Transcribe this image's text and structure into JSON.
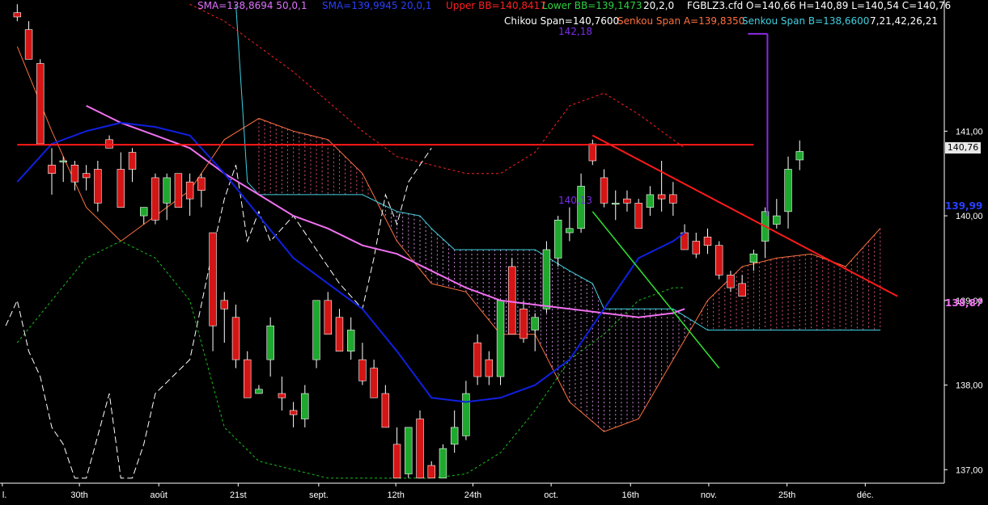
{
  "header": {
    "sma1": "SMA=138,8694  50,0,1",
    "sma2": "SMA=139,9945  20,0,1",
    "upper_bb": "Upper BB=140,8417",
    "lower_bb": "Lower BB=139,1473",
    "bb_params": "20,2,0",
    "ohlc": "FGBLZ3.cfd O=140,66 H=140,89 L=140,54 C=140,76",
    "chikou": "Chikou Span=140,7600",
    "senkou_a": "Senkou Span A=139,8350",
    "senkou_b": "Senkou Span B=138,6600",
    "ichimoku_params": "7,21,42,26,21"
  },
  "annotations": {
    "high_marker": "142,18",
    "low_marker": "140,13"
  },
  "price_axis": {
    "current_price": "140,76",
    "right_marker_1": "139,99",
    "right_marker_2": "138,87"
  },
  "colors": {
    "background": "#000000",
    "bull": "#1fa82e",
    "bear": "#d41515",
    "sma20": "#1020e0",
    "sma50": "#f070f0",
    "upper_bb": "#ff2020",
    "lower_bb": "#18c018",
    "senkou_a": "#ff7040",
    "senkou_b": "#40d0e0",
    "chikou": "#ffffff",
    "purple": "#8a2be2"
  },
  "chart_data": {
    "type": "candlestick",
    "instrument": "FGBLZ3.cfd",
    "ylim": [
      136.85,
      142.55
    ],
    "xlim": [
      -1.5,
      80.5
    ],
    "yticks": [
      {
        "value": 137,
        "label": "137,00"
      },
      {
        "value": 138,
        "label": "138,00"
      },
      {
        "value": 139,
        "label": "139,00"
      },
      {
        "value": 140,
        "label": "140,00"
      },
      {
        "value": 141,
        "label": "141,00"
      }
    ],
    "xticks": [
      {
        "x": -1.3,
        "label": "l."
      },
      {
        "x": 5.4,
        "label": "30th"
      },
      {
        "x": 12.3,
        "label": "août"
      },
      {
        "x": 19.2,
        "label": "21st"
      },
      {
        "x": 26.2,
        "label": "sept."
      },
      {
        "x": 32.9,
        "label": "12th"
      },
      {
        "x": 39.6,
        "label": "24th"
      },
      {
        "x": 46.4,
        "label": "oct."
      },
      {
        "x": 53.3,
        "label": "16th"
      },
      {
        "x": 60.1,
        "label": "nov."
      },
      {
        "x": 66.9,
        "label": "25th"
      },
      {
        "x": 73.7,
        "label": "déc."
      }
    ],
    "candles": [
      {
        "o": 142.4,
        "h": 142.5,
        "l": 142.3,
        "c": 142.35
      },
      {
        "o": 142.2,
        "h": 142.3,
        "l": 141.85,
        "c": 141.85
      },
      {
        "o": 141.8,
        "h": 141.85,
        "l": 140.85,
        "c": 140.85
      },
      {
        "o": 140.6,
        "h": 140.8,
        "l": 140.25,
        "c": 140.5
      },
      {
        "o": 140.65,
        "h": 140.7,
        "l": 140.4,
        "c": 140.65
      },
      {
        "o": 140.6,
        "h": 140.65,
        "l": 140.3,
        "c": 140.4
      },
      {
        "o": 140.5,
        "h": 140.6,
        "l": 140.3,
        "c": 140.45
      },
      {
        "o": 140.55,
        "h": 140.65,
        "l": 140.05,
        "c": 140.15
      },
      {
        "o": 140.9,
        "h": 140.95,
        "l": 140.85,
        "c": 140.8
      },
      {
        "o": 140.55,
        "h": 140.75,
        "l": 140.1,
        "c": 140.1
      },
      {
        "o": 140.75,
        "h": 140.8,
        "l": 140.4,
        "c": 140.55
      },
      {
        "o": 140.0,
        "h": 140.1,
        "l": 139.9,
        "c": 140.1
      },
      {
        "o": 140.45,
        "h": 140.5,
        "l": 139.9,
        "c": 139.95
      },
      {
        "o": 140.15,
        "h": 140.5,
        "l": 139.95,
        "c": 140.45
      },
      {
        "o": 140.5,
        "h": 140.5,
        "l": 140.1,
        "c": 140.1
      },
      {
        "o": 140.4,
        "h": 140.5,
        "l": 140.0,
        "c": 140.2
      },
      {
        "o": 140.45,
        "h": 140.5,
        "l": 140.1,
        "c": 140.3
      },
      {
        "o": 139.8,
        "h": 139.8,
        "l": 138.4,
        "c": 138.7
      },
      {
        "o": 139.0,
        "h": 139.1,
        "l": 138.5,
        "c": 138.9
      },
      {
        "o": 138.8,
        "h": 138.95,
        "l": 138.2,
        "c": 138.3
      },
      {
        "o": 138.3,
        "h": 138.4,
        "l": 137.85,
        "c": 137.85
      },
      {
        "o": 137.9,
        "h": 138.0,
        "l": 137.9,
        "c": 137.95
      },
      {
        "o": 138.3,
        "h": 138.8,
        "l": 138.1,
        "c": 138.7
      },
      {
        "o": 137.9,
        "h": 138.1,
        "l": 137.7,
        "c": 137.85
      },
      {
        "o": 137.7,
        "h": 137.8,
        "l": 137.5,
        "c": 137.65
      },
      {
        "o": 137.6,
        "h": 138.0,
        "l": 137.5,
        "c": 137.9
      },
      {
        "o": 138.3,
        "h": 139.0,
        "l": 138.2,
        "c": 139.0
      },
      {
        "o": 139.0,
        "h": 139.1,
        "l": 138.6,
        "c": 138.6
      },
      {
        "o": 138.8,
        "h": 138.9,
        "l": 138.4,
        "c": 138.4
      },
      {
        "o": 138.4,
        "h": 138.8,
        "l": 138.3,
        "c": 138.65
      },
      {
        "o": 138.3,
        "h": 138.5,
        "l": 138.0,
        "c": 138.05
      },
      {
        "o": 138.2,
        "h": 138.3,
        "l": 137.85,
        "c": 137.85
      },
      {
        "o": 137.9,
        "h": 138.0,
        "l": 137.5,
        "c": 137.5
      },
      {
        "o": 137.3,
        "h": 137.5,
        "l": 136.9,
        "c": 136.9
      },
      {
        "o": 136.95,
        "h": 137.5,
        "l": 136.9,
        "c": 137.5
      },
      {
        "o": 137.6,
        "h": 137.7,
        "l": 136.9,
        "c": 136.9
      },
      {
        "o": 137.05,
        "h": 137.1,
        "l": 136.9,
        "c": 136.9
      },
      {
        "o": 136.9,
        "h": 137.3,
        "l": 136.9,
        "c": 137.25
      },
      {
        "o": 137.3,
        "h": 137.7,
        "l": 137.2,
        "c": 137.5
      },
      {
        "o": 137.4,
        "h": 138.05,
        "l": 137.35,
        "c": 137.9
      },
      {
        "o": 138.5,
        "h": 138.6,
        "l": 138.0,
        "c": 138.1
      },
      {
        "o": 138.3,
        "h": 138.4,
        "l": 138.0,
        "c": 138.1
      },
      {
        "o": 138.1,
        "h": 139.0,
        "l": 138.0,
        "c": 139.0
      },
      {
        "o": 139.4,
        "h": 139.5,
        "l": 138.6,
        "c": 138.6
      },
      {
        "o": 138.9,
        "h": 139.0,
        "l": 138.5,
        "c": 138.55
      },
      {
        "o": 138.65,
        "h": 138.85,
        "l": 138.4,
        "c": 138.8
      },
      {
        "o": 138.9,
        "h": 139.7,
        "l": 138.85,
        "c": 139.6
      },
      {
        "o": 139.5,
        "h": 140.0,
        "l": 139.4,
        "c": 139.95
      },
      {
        "o": 139.8,
        "h": 140.1,
        "l": 139.7,
        "c": 139.85
      },
      {
        "o": 139.85,
        "h": 140.5,
        "l": 139.8,
        "c": 140.35
      },
      {
        "o": 140.85,
        "h": 140.9,
        "l": 140.6,
        "c": 140.65
      },
      {
        "o": 140.45,
        "h": 140.55,
        "l": 140.1,
        "c": 140.15
      },
      {
        "o": 140.15,
        "h": 140.3,
        "l": 139.95,
        "c": 140.15
      },
      {
        "o": 140.2,
        "h": 140.3,
        "l": 140.05,
        "c": 140.15
      },
      {
        "o": 140.15,
        "h": 140.2,
        "l": 139.85,
        "c": 139.85
      },
      {
        "o": 140.1,
        "h": 140.35,
        "l": 140.0,
        "c": 140.25
      },
      {
        "o": 140.25,
        "h": 140.65,
        "l": 140.05,
        "c": 140.2
      },
      {
        "o": 140.25,
        "h": 140.4,
        "l": 140.0,
        "c": 140.15
      },
      {
        "o": 139.8,
        "h": 139.9,
        "l": 139.6,
        "c": 139.6
      },
      {
        "o": 139.7,
        "h": 139.8,
        "l": 139.5,
        "c": 139.55
      },
      {
        "o": 139.75,
        "h": 139.85,
        "l": 139.55,
        "c": 139.65
      },
      {
        "o": 139.65,
        "h": 139.7,
        "l": 139.25,
        "c": 139.3
      },
      {
        "o": 139.3,
        "h": 139.35,
        "l": 139.1,
        "c": 139.15
      },
      {
        "o": 139.2,
        "h": 139.3,
        "l": 139.05,
        "c": 139.05
      },
      {
        "o": 139.45,
        "h": 139.6,
        "l": 139.35,
        "c": 139.55
      },
      {
        "o": 139.7,
        "h": 140.1,
        "l": 139.5,
        "c": 140.05
      },
      {
        "o": 139.9,
        "h": 140.2,
        "l": 139.85,
        "c": 140.0
      },
      {
        "o": 140.05,
        "h": 140.7,
        "l": 139.85,
        "c": 140.55
      },
      {
        "o": 140.66,
        "h": 140.89,
        "l": 140.54,
        "c": 140.76
      }
    ],
    "series": [
      {
        "name": "SMA 20",
        "x": [
          0,
          3,
          6,
          9,
          12,
          15,
          18,
          21,
          24,
          27,
          30,
          33,
          36,
          39,
          42,
          45,
          48,
          51,
          54,
          57,
          58
        ],
        "y": [
          140.4,
          140.85,
          141.0,
          141.1,
          141.05,
          140.95,
          140.5,
          140.0,
          139.5,
          139.2,
          138.9,
          138.4,
          137.85,
          137.8,
          137.85,
          138.0,
          138.3,
          138.9,
          139.5,
          139.7,
          139.8
        ]
      },
      {
        "name": "SMA 50",
        "x": [
          6,
          9,
          12,
          15,
          18,
          21,
          24,
          27,
          30,
          33,
          36,
          39,
          42,
          45,
          48,
          51,
          54,
          57,
          58
        ],
        "y": [
          141.3,
          141.1,
          140.95,
          140.8,
          140.5,
          140.25,
          140.0,
          139.85,
          139.65,
          139.55,
          139.35,
          139.15,
          139.0,
          138.95,
          138.9,
          138.85,
          138.8,
          138.85,
          138.9
        ]
      },
      {
        "name": "Upper BB",
        "x": [
          15,
          18,
          21,
          24,
          27,
          30,
          33,
          36,
          39,
          42,
          45,
          48,
          51,
          54,
          57,
          58
        ],
        "y": [
          142.5,
          142.3,
          142.0,
          141.7,
          141.35,
          141.0,
          140.7,
          140.6,
          140.5,
          140.5,
          140.75,
          141.3,
          141.45,
          141.2,
          140.9,
          140.8
        ]
      },
      {
        "name": "Lower BB",
        "x": [
          0,
          3,
          6,
          9,
          12,
          15,
          18,
          21,
          24,
          27,
          30,
          33,
          36,
          39,
          42,
          45,
          48,
          51,
          54,
          57,
          58
        ],
        "y": [
          138.5,
          139.0,
          139.5,
          139.7,
          139.5,
          139.0,
          137.5,
          137.1,
          137.0,
          136.9,
          136.9,
          136.9,
          136.9,
          136.95,
          137.2,
          137.7,
          138.3,
          138.6,
          139.0,
          139.15,
          139.15
        ]
      },
      {
        "name": "Senkou Span A",
        "x": [
          0,
          3,
          6,
          9,
          12,
          15,
          18,
          21,
          24,
          27,
          30,
          33,
          36,
          39,
          42,
          45,
          48,
          51,
          54,
          57,
          60,
          63,
          66,
          69,
          72,
          75
        ],
        "y": [
          142.0,
          141.0,
          140.1,
          139.7,
          140.0,
          140.3,
          140.9,
          141.15,
          141.0,
          140.9,
          140.5,
          139.7,
          139.2,
          139.1,
          138.6,
          138.6,
          137.8,
          137.45,
          137.6,
          138.3,
          139.0,
          139.4,
          139.5,
          139.55,
          139.4,
          139.85
        ]
      },
      {
        "name": "Senkou Span B",
        "x": [
          19,
          20,
          21,
          24,
          27,
          30,
          33,
          35,
          36,
          38,
          39,
          41,
          45,
          48,
          50,
          51,
          54,
          57,
          60,
          63,
          66,
          69,
          72,
          75
        ],
        "y": [
          142.5,
          140.4,
          140.25,
          140.25,
          140.25,
          140.25,
          140.05,
          140.0,
          139.85,
          139.6,
          139.6,
          139.6,
          139.6,
          139.35,
          139.2,
          138.9,
          138.9,
          138.9,
          138.65,
          138.65,
          138.65,
          138.65,
          138.65,
          138.65
        ]
      },
      {
        "name": "Chikou Span",
        "x": [
          -1,
          0,
          1,
          2,
          3,
          4,
          5,
          6,
          8,
          9,
          10,
          11,
          12,
          15,
          17,
          18,
          19,
          20,
          21,
          22,
          24,
          26,
          28,
          30,
          31,
          32,
          33,
          34,
          35,
          36
        ],
        "y": [
          138.7,
          139.0,
          138.4,
          138.1,
          137.5,
          137.3,
          136.9,
          136.9,
          137.9,
          136.9,
          136.9,
          137.3,
          137.9,
          138.3,
          139.6,
          140.2,
          140.6,
          139.7,
          140.05,
          139.7,
          140.0,
          139.6,
          139.2,
          138.9,
          139.5,
          140.25,
          139.9,
          140.4,
          140.6,
          140.8
        ]
      }
    ]
  }
}
